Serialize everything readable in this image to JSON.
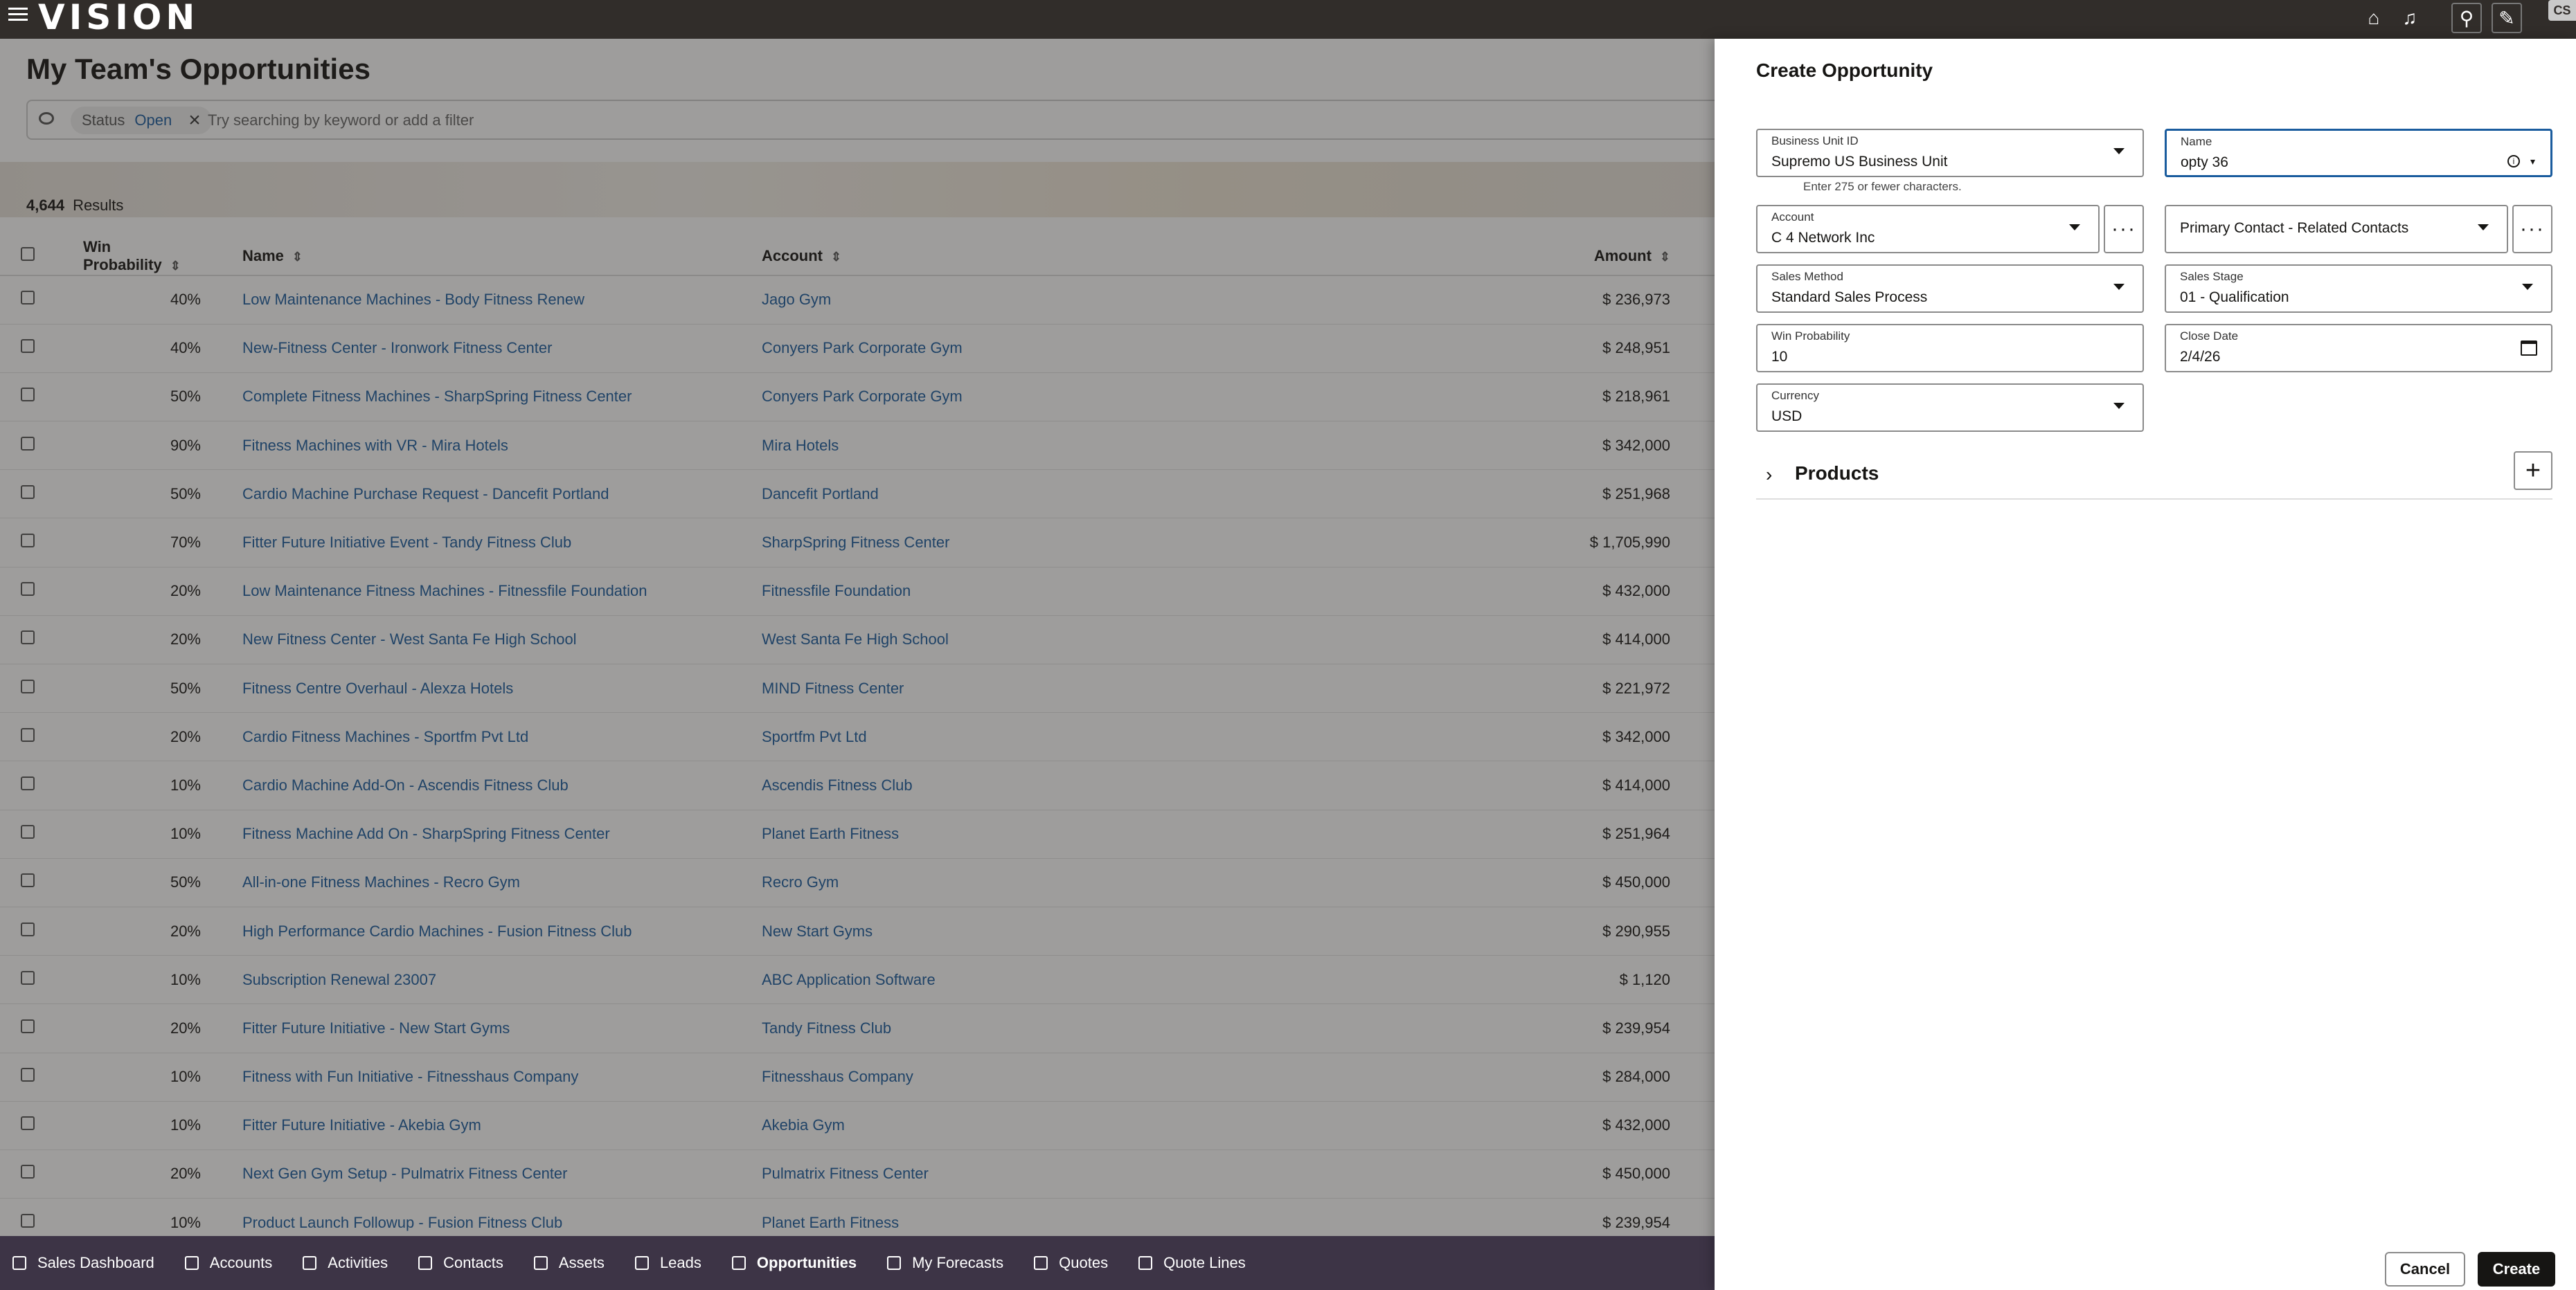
{
  "app": {
    "logo": "VISION",
    "avatar_initials": "CS"
  },
  "page": {
    "title": "My Team's Opportunities",
    "filter_key": "Status",
    "filter_value": "Open",
    "search_placeholder": "Try searching by keyword or add a filter",
    "results_count": "4,644",
    "results_label": "Results"
  },
  "table": {
    "headers": {
      "win_probability": "Win Probability",
      "name": "Name",
      "account": "Account",
      "amount": "Amount"
    },
    "rows": [
      {
        "wp": "40%",
        "name": "Low Maintenance Machines - Body Fitness Renew",
        "account": "Jago Gym",
        "amount": "$ 236,973"
      },
      {
        "wp": "40%",
        "name": "New-Fitness Center - Ironwork Fitness Center",
        "account": "Conyers Park Corporate Gym",
        "amount": "$ 248,951"
      },
      {
        "wp": "50%",
        "name": "Complete Fitness Machines - SharpSpring Fitness Center",
        "account": "Conyers Park Corporate Gym",
        "amount": "$ 218,961"
      },
      {
        "wp": "90%",
        "name": "Fitness Machines with VR - Mira Hotels",
        "account": "Mira Hotels",
        "amount": "$ 342,000"
      },
      {
        "wp": "50%",
        "name": "Cardio Machine Purchase Request - Dancefit Portland",
        "account": "Dancefit Portland",
        "amount": "$ 251,968"
      },
      {
        "wp": "70%",
        "name": "Fitter Future Initiative Event - Tandy Fitness Club",
        "account": "SharpSpring Fitness Center",
        "amount": "$ 1,705,990"
      },
      {
        "wp": "20%",
        "name": "Low Maintenance Fitness Machines - Fitnessfile Foundation",
        "account": "Fitnessfile Foundation",
        "amount": "$ 432,000"
      },
      {
        "wp": "20%",
        "name": "New Fitness Center - West Santa Fe High School",
        "account": "West Santa Fe High School",
        "amount": "$ 414,000"
      },
      {
        "wp": "50%",
        "name": "Fitness Centre Overhaul - Alexza Hotels",
        "account": "MIND Fitness Center",
        "amount": "$ 221,972"
      },
      {
        "wp": "20%",
        "name": "Cardio Fitness Machines - Sportfm Pvt Ltd",
        "account": "Sportfm Pvt Ltd",
        "amount": "$ 342,000"
      },
      {
        "wp": "10%",
        "name": "Cardio Machine Add-On - Ascendis Fitness Club",
        "account": "Ascendis Fitness Club",
        "amount": "$ 414,000"
      },
      {
        "wp": "10%",
        "name": "Fitness Machine Add On - SharpSpring Fitness Center",
        "account": "Planet Earth Fitness",
        "amount": "$ 251,964"
      },
      {
        "wp": "50%",
        "name": "All-in-one Fitness Machines - Recro Gym",
        "account": "Recro Gym",
        "amount": "$ 450,000"
      },
      {
        "wp": "20%",
        "name": "High Performance Cardio Machines - Fusion Fitness Club",
        "account": "New Start Gyms",
        "amount": "$ 290,955"
      },
      {
        "wp": "10%",
        "name": "Subscription Renewal 23007",
        "account": "ABC Application Software",
        "amount": "$ 1,120"
      },
      {
        "wp": "20%",
        "name": "Fitter Future Initiative - New Start Gyms",
        "account": "Tandy Fitness Club",
        "amount": "$ 239,954"
      },
      {
        "wp": "10%",
        "name": "Fitness with Fun Initiative - Fitnesshaus Company",
        "account": "Fitnesshaus Company",
        "amount": "$ 284,000"
      },
      {
        "wp": "10%",
        "name": "Fitter Future Initiative - Akebia Gym",
        "account": "Akebia Gym",
        "amount": "$ 432,000"
      },
      {
        "wp": "20%",
        "name": "Next Gen Gym Setup - Pulmatrix Fitness Center",
        "account": "Pulmatrix Fitness Center",
        "amount": "$ 450,000"
      },
      {
        "wp": "10%",
        "name": "Product Launch Followup - Fusion Fitness Club",
        "account": "Planet Earth Fitness",
        "amount": "$ 239,954"
      }
    ]
  },
  "bottom_nav": [
    {
      "label": "Sales Dashboard",
      "active": false
    },
    {
      "label": "Accounts",
      "active": false
    },
    {
      "label": "Activities",
      "active": false
    },
    {
      "label": "Contacts",
      "active": false
    },
    {
      "label": "Assets",
      "active": false
    },
    {
      "label": "Leads",
      "active": false
    },
    {
      "label": "Opportunities",
      "active": true
    },
    {
      "label": "My Forecasts",
      "active": false
    },
    {
      "label": "Quotes",
      "active": false
    },
    {
      "label": "Quote Lines",
      "active": false
    }
  ],
  "drawer": {
    "title": "Create Opportunity",
    "business_unit": {
      "label": "Business Unit ID",
      "value": "Supremo US Business Unit"
    },
    "name": {
      "label": "Name",
      "value": "opty 36",
      "hint": "Enter 275 or fewer characters."
    },
    "account": {
      "label": "Account",
      "value": "C 4 Network Inc"
    },
    "primary_contact": {
      "value": "Primary Contact - Related Contacts"
    },
    "sales_method": {
      "label": "Sales Method",
      "value": "Standard Sales Process"
    },
    "sales_stage": {
      "label": "Sales Stage",
      "value": "01 - Qualification"
    },
    "win_probability": {
      "label": "Win Probability",
      "value": "10"
    },
    "close_date": {
      "label": "Close Date",
      "value": "2/4/26"
    },
    "currency": {
      "label": "Currency",
      "value": "USD"
    },
    "products_label": "Products",
    "cancel_label": "Cancel",
    "create_label": "Create"
  }
}
